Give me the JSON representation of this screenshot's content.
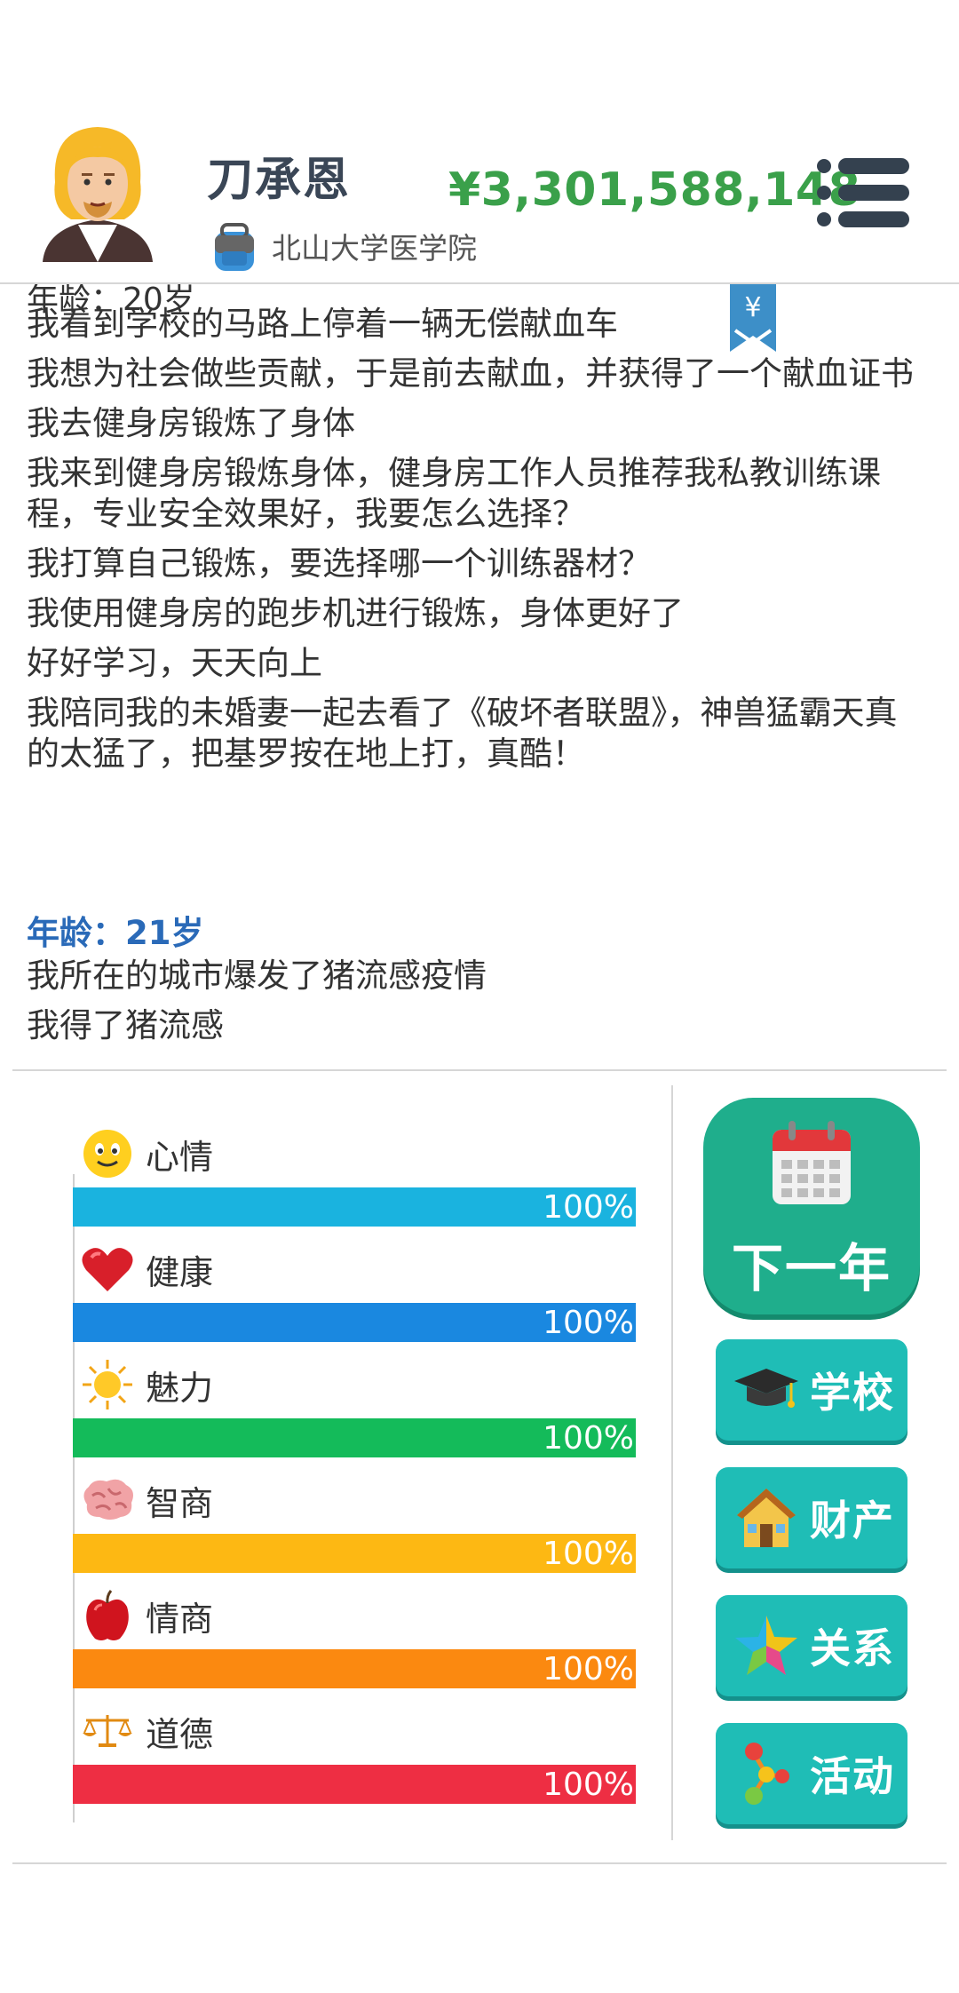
{
  "player": {
    "name": "刀承恩",
    "school": "北山大学医学院",
    "money": "¥3,301,588,148"
  },
  "log": {
    "cut_top_text": "年龄：20岁",
    "lines": [
      "我看到学校的马路上停着一辆无偿献血车",
      "我想为社会做些贡献，于是前去献血，并获得了一个献血证书",
      "我去健身房锻炼了身体",
      "我来到健身房锻炼身体，健身房工作人员推荐我私教训练课程，专业安全效果好，我要怎么选择？",
      "我打算自己锻炼，要选择哪一个训练器材？",
      "我使用健身房的跑步机进行锻炼，身体更好了",
      "好好学习，天天向上",
      "我陪同我的未婚妻一起去看了《破坏者联盟》，神兽猛霸天真的太猛了，把基罗按在地上打，真酷！"
    ],
    "age_title": "年龄：21岁",
    "age_lines": [
      "我所在的城市爆发了猪流感疫情",
      "我得了猪流感"
    ],
    "bookmark_symbol": "¥"
  },
  "stats": [
    {
      "label": "心情",
      "percent": "100%",
      "value": 1.0,
      "color": "#1ab3df",
      "icon": "smiley-icon"
    },
    {
      "label": "健康",
      "percent": "100%",
      "value": 1.0,
      "color": "#1a88e0",
      "icon": "heart-icon"
    },
    {
      "label": "魅力",
      "percent": "100%",
      "value": 1.0,
      "color": "#14bb5a",
      "icon": "sun-icon"
    },
    {
      "label": "智商",
      "percent": "100%",
      "value": 1.0,
      "color": "#fdb813",
      "icon": "brain-icon"
    },
    {
      "label": "情商",
      "percent": "100%",
      "value": 1.0,
      "color": "#fb8910",
      "icon": "apple-icon"
    },
    {
      "label": "道德",
      "percent": "100%",
      "value": 1.0,
      "color": "#ee2e43",
      "icon": "scales-icon"
    }
  ],
  "actions": {
    "next_year": "下一年",
    "school": "学校",
    "property": "财产",
    "relations": "关系",
    "activities": "活动"
  },
  "colors": {
    "money": "#3aa04a",
    "age_title": "#2a6ab8",
    "next_button": "#1fae8c",
    "action_button": "#1fbdb6"
  }
}
